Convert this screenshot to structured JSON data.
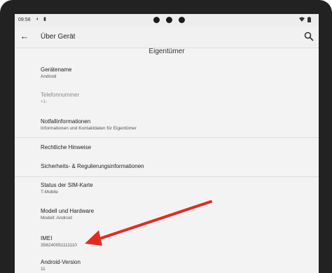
{
  "status_bar": {
    "time": "09:58",
    "icons": [
      "sync-icon",
      "sim-icon",
      "wifi-icon",
      "battery-icon"
    ]
  },
  "app_bar": {
    "title": "Über Gerät",
    "back_icon": "back-arrow-icon",
    "search_icon": "search-icon"
  },
  "section": {
    "header": "Eigentümer"
  },
  "items": [
    {
      "title": "Gerätename",
      "subtitle": "Android"
    },
    {
      "title": "Telefonnummer",
      "subtitle": "+1-",
      "disabled": true
    },
    {
      "title": "Notfallinformationen",
      "subtitle": "Informationen und Kontaktdaten für Eigentümer"
    },
    {
      "title": "Rechtliche Hinweise"
    },
    {
      "title": "Sicherheits- & Regulierungsinformationen"
    },
    {
      "title": "Status der SIM-Karte",
      "subtitle": "T-Mobile"
    },
    {
      "title": "Modell und Hardware",
      "subtitle": "Modell: Android"
    },
    {
      "title": "IMEI",
      "subtitle": "358240051111110"
    },
    {
      "title": "Android-Version",
      "subtitle": "11"
    }
  ],
  "colors": {
    "arrow": "#e32b22",
    "screen_bg": "#f3f3f3",
    "bezel": "#222222"
  }
}
